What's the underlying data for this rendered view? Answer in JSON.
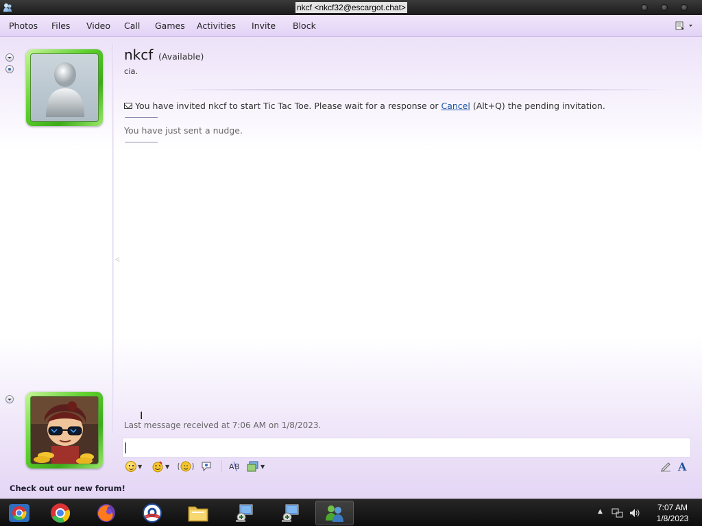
{
  "window": {
    "title": "nkcf <nkcf32@escargot.chat>"
  },
  "menu": [
    "Photos",
    "Files",
    "Video",
    "Call",
    "Games",
    "Activities",
    "Invite",
    "Block"
  ],
  "contact": {
    "name": "nkcf",
    "status": "(Available)",
    "personal_message": "cia."
  },
  "conversation": {
    "invite_prefix": "You have invited nkcf to start Tic Tac Toe. Please wait for a response or",
    "invite_cancel_link": "Cancel",
    "invite_suffix": "(Alt+Q) the pending invitation.",
    "nudge_text": "You have just sent a nudge."
  },
  "last_message": "Last message received at 7:06 AM on 1/8/2023.",
  "input": {
    "value": ""
  },
  "sidebar": {
    "forum_text": "Check out our new forum!"
  },
  "toolbar_icons": [
    "emoticon-icon",
    "wink-icon",
    "nudge-icon",
    "voice-clip-icon",
    "spell-check-icon",
    "background-icon",
    "handwriting-icon",
    "font-icon"
  ],
  "taskbar": {
    "apps": [
      "chrome-icon",
      "chrome-icon",
      "firefox-icon",
      "obama-icon",
      "file-explorer-icon",
      "msn-messenger-icon",
      "msn-messenger-icon",
      "buddy-list-icon"
    ],
    "time": "7:07 AM",
    "date": "1/8/2023"
  },
  "colors": {
    "accent": "#1b57a5",
    "frame_green": "#4cc324",
    "window_tint": "#e9dcf7"
  }
}
